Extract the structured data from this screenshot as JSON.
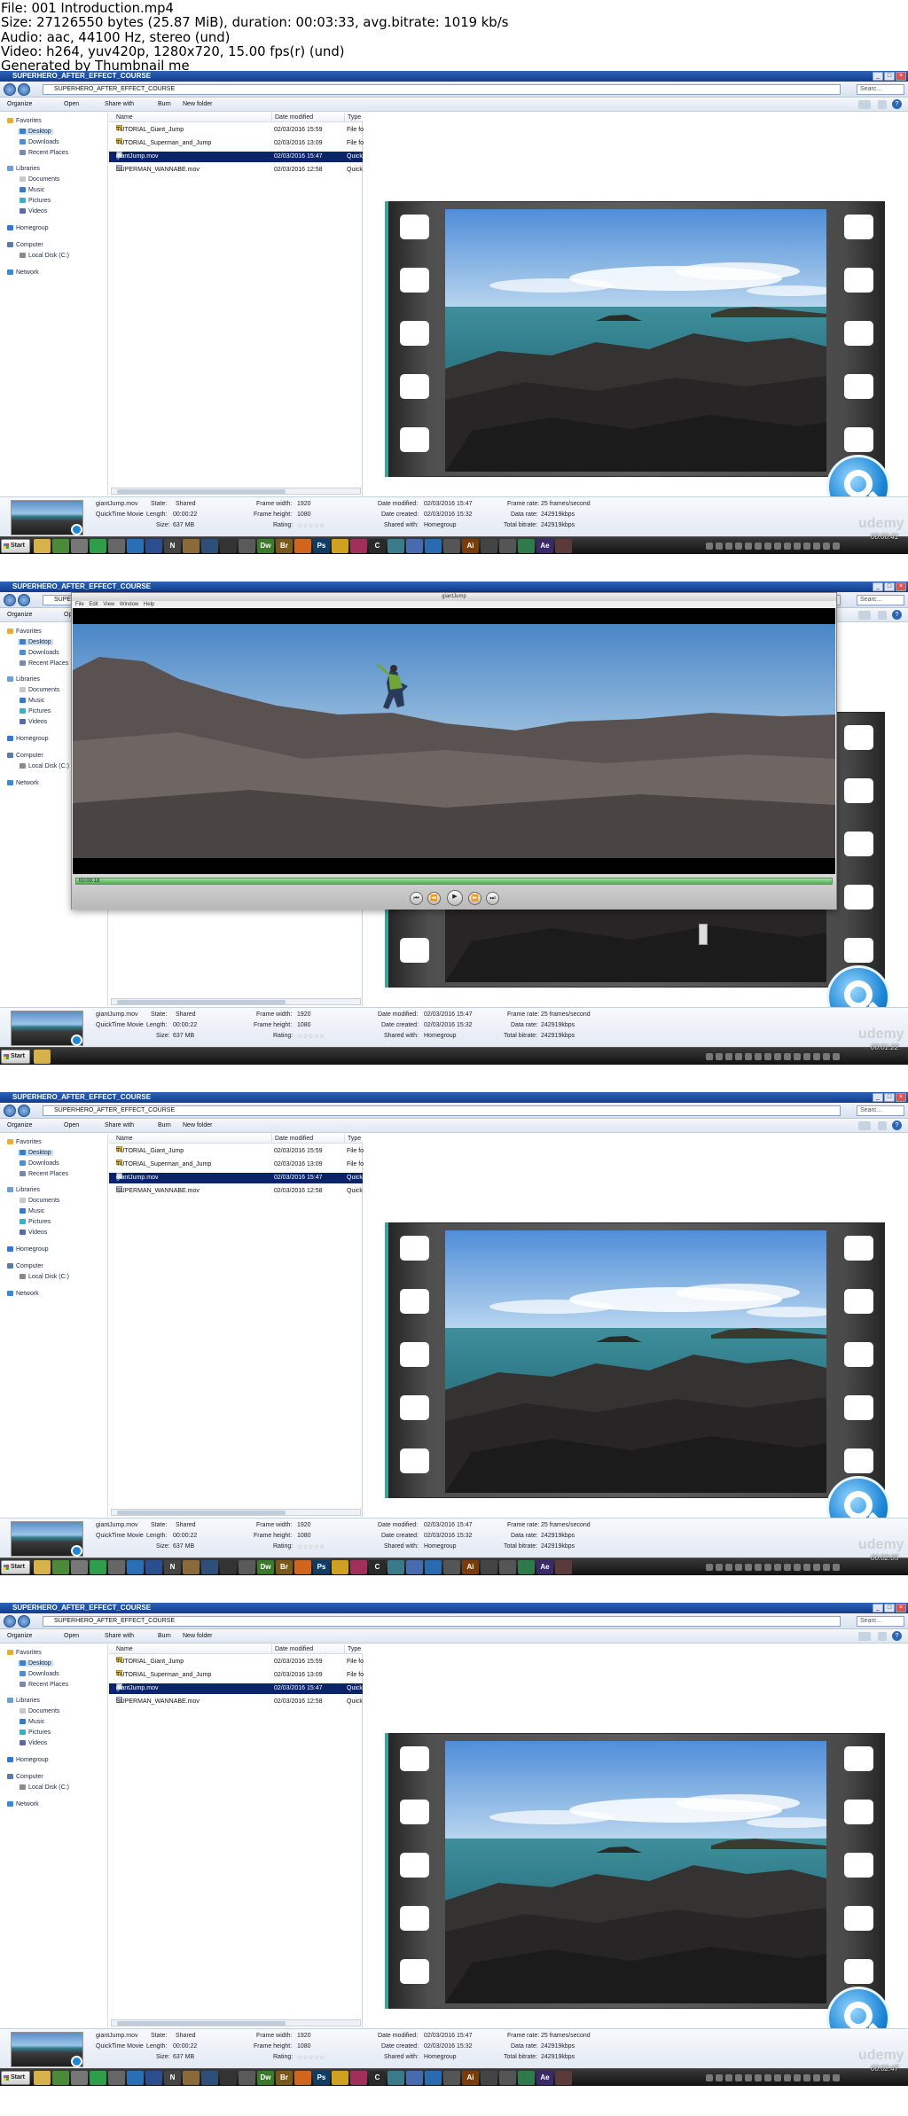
{
  "header": {
    "lines": [
      "File: 001 Introduction.mp4",
      "Size: 27126550 bytes (25.87 MiB), duration: 00:03:33, avg.bitrate: 1019 kb/s",
      "Audio: aac, 44100 Hz, stereo (und)",
      "Video: h264, yuv420p, 1280x720, 15.00 fps(r) (und)",
      "Generated by Thumbnail me"
    ]
  },
  "explorer": {
    "window_title": "SUPERHERO_AFTER_EFFECT_COURSE",
    "address": "SUPERHERO_AFTER_EFFECT_COURSE",
    "search_placeholder": "Searc...",
    "toolbar": {
      "organize": "Organize",
      "open": "Open",
      "share": "Share with",
      "burn": "Burn",
      "new_folder": "New folder"
    },
    "nav": [
      {
        "label": "Favorites",
        "level": 0,
        "icon": "star-icon"
      },
      {
        "label": "Desktop",
        "level": 1,
        "icon": "desktop-icon",
        "selected": true
      },
      {
        "label": "Downloads",
        "level": 1,
        "icon": "downloads-icon"
      },
      {
        "label": "Recent Places",
        "level": 1,
        "icon": "recent-places-icon"
      },
      {
        "label": "Libraries",
        "level": 0,
        "icon": "libraries-icon"
      },
      {
        "label": "Documents",
        "level": 1,
        "icon": "documents-icon"
      },
      {
        "label": "Music",
        "level": 1,
        "icon": "music-icon"
      },
      {
        "label": "Pictures",
        "level": 1,
        "icon": "pictures-icon"
      },
      {
        "label": "Videos",
        "level": 1,
        "icon": "videos-icon"
      },
      {
        "label": "Homegroup",
        "level": 0,
        "icon": "homegroup-icon"
      },
      {
        "label": "Computer",
        "level": 0,
        "icon": "computer-icon"
      },
      {
        "label": "Local Disk (C:)",
        "level": 1,
        "icon": "disk-icon"
      },
      {
        "label": "Network",
        "level": 0,
        "icon": "network-icon"
      }
    ],
    "columns": {
      "name": "Name",
      "date": "Date modified",
      "type": "Type"
    },
    "files": [
      {
        "name": "TUTORIAL_Giant_Jump",
        "date": "02/03/2016 15:59",
        "type": "File fo",
        "kind": "folder"
      },
      {
        "name": "TUTORIAL_Superman_and_Jump",
        "date": "02/03/2016 13:09",
        "type": "File fo",
        "kind": "folder"
      },
      {
        "name": "giantJump.mov",
        "date": "02/03/2016 15:47",
        "type": "Quick",
        "kind": "movie",
        "selected": true
      },
      {
        "name": "SUPERMAN_WANNABE.mov",
        "date": "02/03/2016 12:58",
        "type": "Quick",
        "kind": "movie"
      }
    ],
    "details": {
      "filename": "giantJump.mov",
      "filetype": "QuickTime Movie",
      "state_label": "State:",
      "state_value": "Shared",
      "length_label": "Length:",
      "length_value": "00:00:22",
      "size_label": "Size:",
      "size_value": "637 MB",
      "fw_label": "Frame width:",
      "fw_value": "1920",
      "fh_label": "Frame height:",
      "fh_value": "1080",
      "rating_label": "Rating:",
      "rating_value": "☆☆☆☆☆",
      "dm_label": "Date modified:",
      "dm_value": "02/03/2016 15:47",
      "dc_label": "Date created:",
      "dc_value": "02/03/2016 15:32",
      "sw_label": "Shared with:",
      "sw_value": "Homegroup",
      "fr_label": "Frame rate:",
      "fr_value": "25 frames/second",
      "dr_label": "Data rate:",
      "dr_value": "242919kbps",
      "tb_label": "Total bitrate:",
      "tb_value": "242919kbps"
    }
  },
  "taskbar": {
    "start": "Start",
    "apps": [
      {
        "label": "",
        "icon": "folder-icon",
        "color": "#d7b24a"
      },
      {
        "label": "",
        "icon": "grid-icon",
        "color": "#4b8a3b"
      },
      {
        "label": "",
        "icon": "gear-icon",
        "color": "#777777"
      },
      {
        "label": "",
        "icon": "chrome-icon",
        "color": "#2e9e4a"
      },
      {
        "label": "",
        "icon": "panel-icon",
        "color": "#666666"
      },
      {
        "label": "",
        "icon": "flag-icon",
        "color": "#2a6fb5"
      },
      {
        "label": "",
        "icon": "app-icon",
        "color": "#2c4d8e"
      },
      {
        "label": "N",
        "icon": "n-icon",
        "color": "#444444"
      },
      {
        "label": "",
        "icon": "box-icon",
        "color": "#8a6a3a"
      },
      {
        "label": "",
        "icon": "download-icon",
        "color": "#2d4f7a"
      },
      {
        "label": "",
        "icon": "fx-icon",
        "color": "#333333"
      },
      {
        "label": "",
        "icon": "circle-icon",
        "color": "#5a5a5a"
      },
      {
        "label": "Dw",
        "icon": "dreamweaver-icon",
        "color": "#3b7a2b"
      },
      {
        "label": "Br",
        "icon": "bridge-icon",
        "color": "#7a5a1a"
      },
      {
        "label": "",
        "icon": "firefox-icon",
        "color": "#d0661e"
      },
      {
        "label": "Ps",
        "icon": "photoshop-icon",
        "color": "#0f3d66"
      },
      {
        "label": "",
        "icon": "headphones-icon",
        "color": "#d0a020"
      },
      {
        "label": "",
        "icon": "flower-icon",
        "color": "#a0305a"
      },
      {
        "label": "C",
        "icon": "c-icon",
        "color": "#2a2a2a"
      },
      {
        "label": "",
        "icon": "cube-icon",
        "color": "#3a7a8a"
      },
      {
        "label": "",
        "icon": "af-icon",
        "color": "#4a6ab0"
      },
      {
        "label": "",
        "icon": "hex-icon",
        "color": "#2a6ab0"
      },
      {
        "label": "",
        "icon": "figure-icon",
        "color": "#555555"
      },
      {
        "label": "Ai",
        "icon": "illustrator-icon",
        "color": "#7a3d0a"
      },
      {
        "label": "",
        "icon": "arrow-icon",
        "color": "#444444"
      },
      {
        "label": "",
        "icon": "unity-icon",
        "color": "#555555"
      },
      {
        "label": "",
        "icon": "tri-icon",
        "color": "#2f7a4a"
      },
      {
        "label": "Ae",
        "icon": "aftereffects-icon",
        "color": "#3a2a6a"
      },
      {
        "label": "",
        "icon": "disc-icon",
        "color": "#5a3a3a"
      }
    ],
    "clock": ""
  },
  "quicktime": {
    "title": "giantJump",
    "menu": "File Edit View Window Help",
    "time": "00:00:18"
  },
  "timestamps": [
    "00:00:41",
    "00:01:22",
    "00:02:05",
    "00:02:47"
  ],
  "watermark": "udemy"
}
